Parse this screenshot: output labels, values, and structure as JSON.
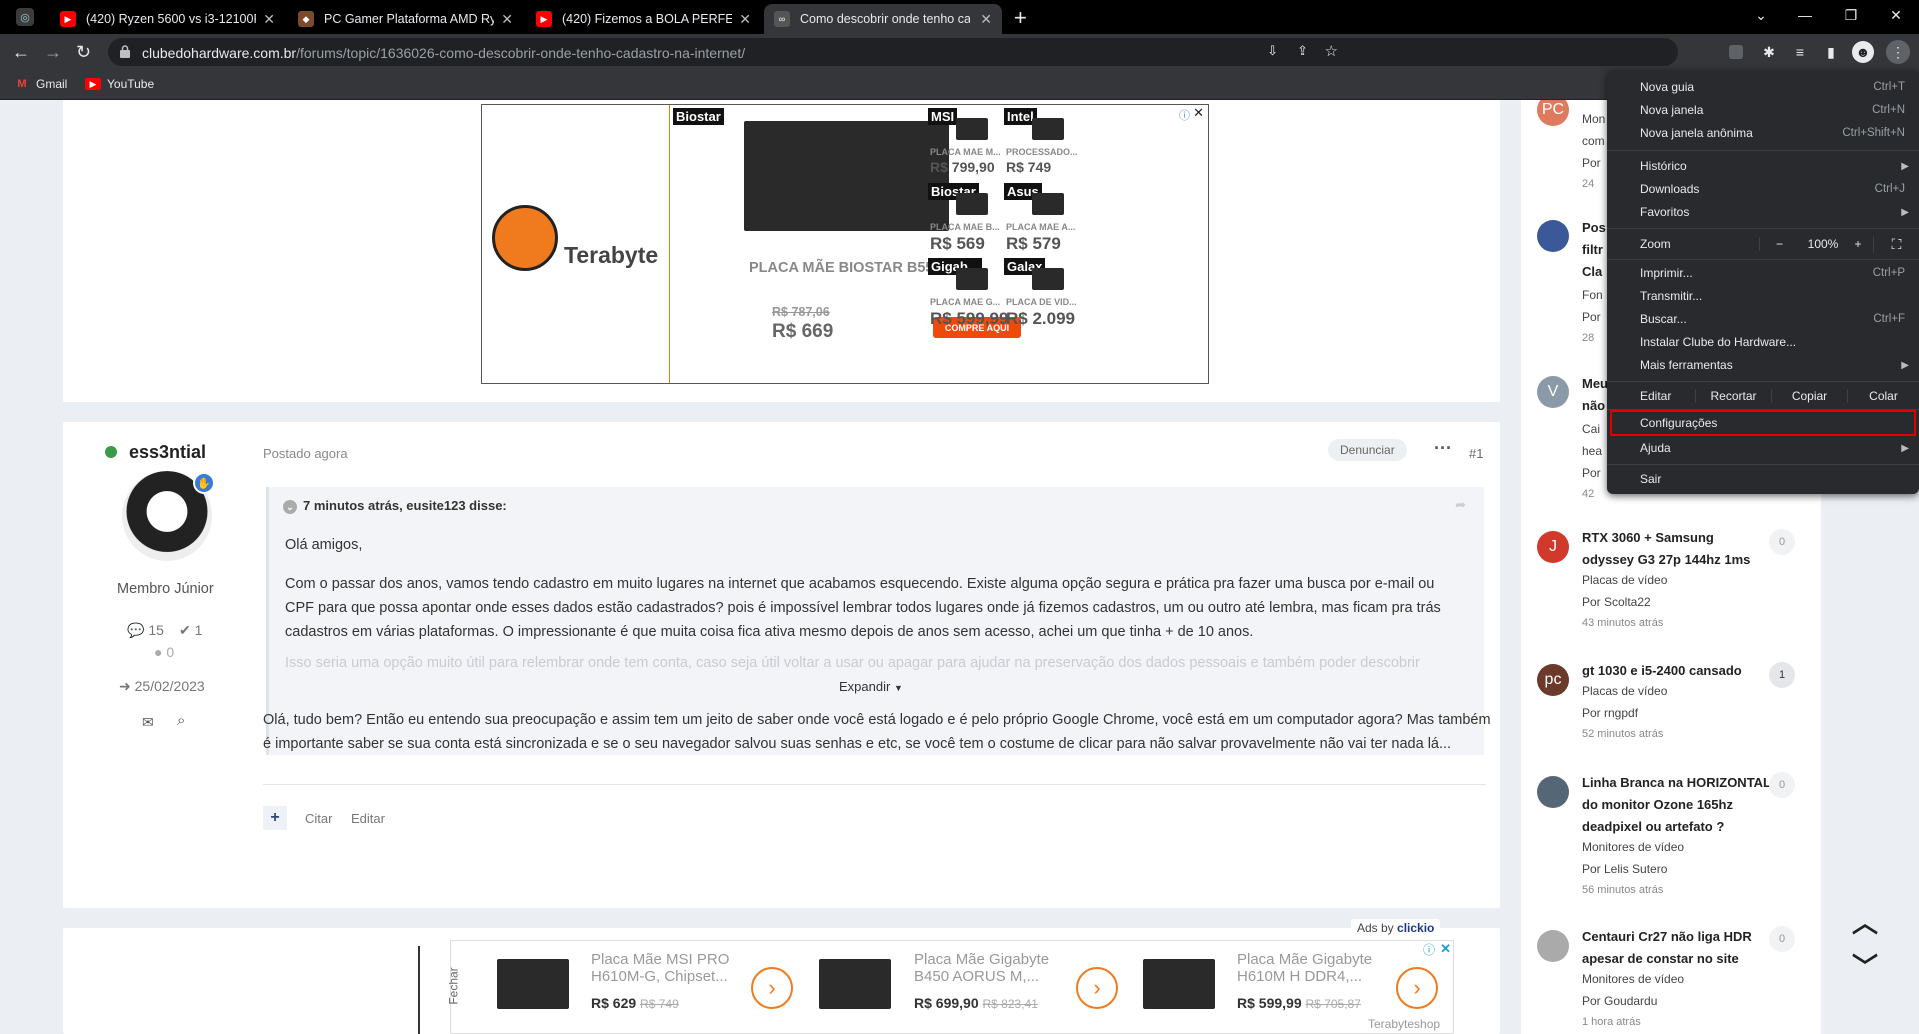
{
  "tabs": [
    {
      "title": "(420) Ryzen 5600 vs i3-12100F in",
      "icon": "youtube-icon",
      "color": "#ff0000"
    },
    {
      "title": "PC Gamer Plataforma AMD Ryze",
      "icon": "tab-favicon",
      "color": "#7a4a2a"
    },
    {
      "title": "(420) Fizemos a BOLA PERFEITA",
      "icon": "youtube-icon",
      "color": "#ff0000"
    },
    {
      "title": "Como descobrir onde tenho cad",
      "icon": "tab-favicon",
      "color": "#444"
    }
  ],
  "address": {
    "domain": "clubedohardware.com.br",
    "path": "/forums/topic/1636026-como-descobrir-onde-tenho-cadastro-na-internet/"
  },
  "bookmarks": [
    "Gmail",
    "YouTube"
  ],
  "ad_top": {
    "brand": "Terabyte",
    "main_brand": "Biostar",
    "main_title": "PLACA MÃE BIOSTAR B55...",
    "main_old_price": "R$ 787,06",
    "main_price": "R$ 669",
    "cta": "COMPRE AQUI",
    "tiles": [
      {
        "brand": "MSI",
        "name": "PLACA MAE M...",
        "price": "R$ 799,90"
      },
      {
        "brand": "Intel",
        "name": "PROCESSADO...",
        "price": "R$ 749"
      },
      {
        "brand": "Biostar",
        "name": "PLACA MAE B...",
        "price": "R$ 569"
      },
      {
        "brand": "Asus",
        "name": "PLACA MAE A...",
        "price": "R$ 579"
      },
      {
        "brand": "Gigab...",
        "name": "PLACA MAE G...",
        "price": "R$ 599,99"
      },
      {
        "brand": "Galax",
        "name": "PLACA DE VID...",
        "price": "R$ 2.099"
      }
    ]
  },
  "post": {
    "author": "ess3ntial",
    "posted": "Postado agora",
    "report": "Denunciar",
    "number": "#1",
    "role": "Membro Júnior",
    "posts_count": "15",
    "rep_count": "1",
    "reaction_count": "0",
    "joined": "25/02/2023",
    "quote_header": "7 minutos atrás, eusite123 disse:",
    "quote_p1": "Olá amigos,",
    "quote_p2": "Com o passar dos anos, vamos tendo cadastro em muito lugares na internet que acabamos esquecendo. Existe alguma opção segura e prática pra fazer uma busca por e-mail ou CPF para que possa apontar onde esses dados estão cadastrados? pois é impossível lembrar todos lugares onde já fizemos cadastros, um ou outro até lembra, mas ficam pra trás cadastros em várias plataformas. O impressionante é que muita coisa fica ativa mesmo depois de anos sem acesso, achei um que tinha + de 10 anos.",
    "quote_p3": "Isso seria uma opção muito útil para relembrar onde tem conta, caso seja útil voltar a usar ou apagar para ajudar na preservação dos dados pessoais e também poder descobrir",
    "expand": "Expandir",
    "body": "Olá, tudo bem? Então eu entendo sua preocupação e assim tem um jeito de saber onde você está logado e é pelo próprio Google Chrome, você está em um computador agora? Mas também é importante saber se sua conta está sincronizada e se o seu navegador salvou suas senhas e etc, se você tem o costume de clicar para não salvar provavelmente não vai ter nada lá...",
    "quote_btn": "Citar",
    "edit_btn": "Editar"
  },
  "sidebar": [
    {
      "avatar": "PC",
      "color": "#e07a5f",
      "title": "",
      "lines": [
        "Mon",
        "com",
        "Por"
      ],
      "time": "24"
    },
    {
      "avatar": "",
      "color": "#3b5998",
      "title": "Pos filtr Cla",
      "lines": [
        "Fon",
        "Por"
      ],
      "time": "28"
    },
    {
      "avatar": "V",
      "color": "#8a9aa8",
      "title": "Meu não",
      "lines": [
        "Cai",
        "hea",
        "Por"
      ],
      "time": "42"
    },
    {
      "avatar": "J",
      "color": "#d0392b",
      "title": "RTX 3060 + Samsung odyssey G3 27p 144hz 1ms",
      "lines": [
        "Placas de vídeo",
        "Por Scolta22"
      ],
      "time": "43 minutos atrás",
      "count": "0"
    },
    {
      "avatar": "pc",
      "color": "#6b3a2a",
      "title": "gt 1030 e i5-2400 cansado",
      "lines": [
        "Placas de vídeo",
        "Por rngpdf"
      ],
      "time": "52 minutos atrás",
      "count": "1"
    },
    {
      "avatar": "",
      "color": "#556677",
      "title": "Linha Branca na HORIZONTAL do monitor Ozone 165hz deadpixel ou artefato ?",
      "lines": [
        "Monitores de vídeo",
        "Por Lelis Sutero"
      ],
      "time": "56 minutos atrás",
      "count": "0"
    },
    {
      "avatar": "",
      "color": "#aaaaaa",
      "title": "Centauri Cr27 não liga HDR apesar de constar no site",
      "lines": [
        "Monitores de vídeo",
        "Por Goudardu"
      ],
      "time": "1 hora atrás",
      "count": "0"
    }
  ],
  "menu": {
    "items": [
      {
        "label": "Nova guia",
        "shortcut": "Ctrl+T"
      },
      {
        "label": "Nova janela",
        "shortcut": "Ctrl+N"
      },
      {
        "label": "Nova janela anônima",
        "shortcut": "Ctrl+Shift+N"
      },
      {
        "label": "Histórico",
        "arrow": true
      },
      {
        "label": "Downloads",
        "shortcut": "Ctrl+J"
      },
      {
        "label": "Favoritos",
        "arrow": true
      },
      {
        "label": "Imprimir...",
        "shortcut": "Ctrl+P"
      },
      {
        "label": "Transmitir..."
      },
      {
        "label": "Buscar...",
        "shortcut": "Ctrl+F"
      },
      {
        "label": "Instalar Clube do Hardware..."
      },
      {
        "label": "Mais ferramentas",
        "arrow": true
      },
      {
        "label": "Configurações"
      },
      {
        "label": "Ajuda",
        "arrow": true
      },
      {
        "label": "Sair"
      }
    ],
    "zoom_label": "Zoom",
    "zoom_minus": "−",
    "zoom_value": "100%",
    "zoom_plus": "+",
    "edit_label": "Editar",
    "cut": "Recortar",
    "copy": "Copiar",
    "paste": "Colar"
  },
  "ad_bottom": {
    "ads_by": "Ads by",
    "ads_brand": "clickio",
    "close": "Fechar",
    "footer": "Terabyteshop",
    "items": [
      {
        "title": "Placa Mãe MSI PRO H610M-G, Chipset...",
        "price": "R$ 629",
        "old": "R$ 749"
      },
      {
        "title": "Placa Mãe Gigabyte B450 AORUS M,...",
        "price": "R$ 699,90",
        "old": "R$ 823,41"
      },
      {
        "title": "Placa Mãe Gigabyte H610M H DDR4,...",
        "price": "R$ 599,99",
        "old": "R$ 705,87"
      }
    ]
  }
}
